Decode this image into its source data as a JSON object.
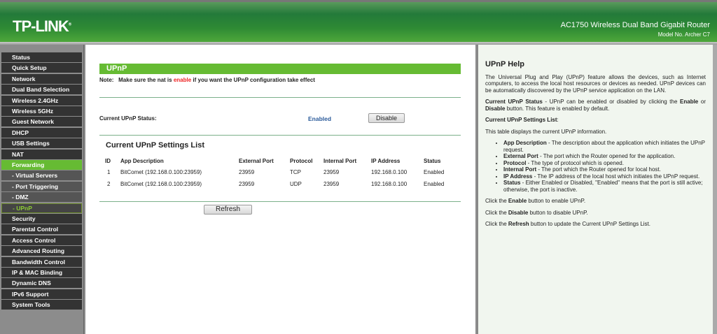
{
  "header": {
    "brand": "TP-LINK",
    "product": "AC1750 Wireless Dual Band Gigabit Router",
    "model": "Model No. Archer C7"
  },
  "sidebar": {
    "items": [
      {
        "label": "Status",
        "type": "main"
      },
      {
        "label": "Quick Setup",
        "type": "main"
      },
      {
        "label": "Network",
        "type": "main"
      },
      {
        "label": "Dual Band Selection",
        "type": "main"
      },
      {
        "label": "Wireless 2.4GHz",
        "type": "main"
      },
      {
        "label": "Wireless 5GHz",
        "type": "main"
      },
      {
        "label": "Guest Network",
        "type": "main"
      },
      {
        "label": "DHCP",
        "type": "main"
      },
      {
        "label": "USB Settings",
        "type": "main"
      },
      {
        "label": "NAT",
        "type": "main"
      },
      {
        "label": "Forwarding",
        "type": "active"
      },
      {
        "label": "- Virtual Servers",
        "type": "sub"
      },
      {
        "label": "- Port Triggering",
        "type": "sub"
      },
      {
        "label": "- DMZ",
        "type": "sub"
      },
      {
        "label": "- UPnP",
        "type": "cur"
      },
      {
        "label": "Security",
        "type": "main"
      },
      {
        "label": "Parental Control",
        "type": "main"
      },
      {
        "label": "Access Control",
        "type": "main"
      },
      {
        "label": "Advanced Routing",
        "type": "main"
      },
      {
        "label": "Bandwidth Control",
        "type": "main"
      },
      {
        "label": "IP & MAC Binding",
        "type": "main"
      },
      {
        "label": "Dynamic DNS",
        "type": "main"
      },
      {
        "label": "IPv6 Support",
        "type": "main"
      },
      {
        "label": "System Tools",
        "type": "main"
      }
    ]
  },
  "main": {
    "title": "UPnP",
    "note_label": "Note:",
    "note_pre": "Make sure the nat is ",
    "note_red": "enable",
    "note_post": " if you want the UPnP configuration take effect",
    "status_label": "Current UPnP Status:",
    "status_value": "Enabled",
    "disable_button": "Disable",
    "list_title": "Current UPnP Settings List",
    "columns": [
      "ID",
      "App Description",
      "External Port",
      "Protocol",
      "Internal Port",
      "IP Address",
      "Status"
    ],
    "rows": [
      [
        "1",
        "BitComet (192.168.0.100:23959)",
        "23959",
        "TCP",
        "23959",
        "192.168.0.100",
        "Enabled"
      ],
      [
        "2",
        "BitComet (192.168.0.100:23959)",
        "23959",
        "UDP",
        "23959",
        "192.168.0.100",
        "Enabled"
      ]
    ],
    "refresh_button": "Refresh"
  },
  "help": {
    "title": "UPnP Help",
    "intro": "The Universal Plug and Play (UPnP) feature allows the devices, such as Internet computers, to access the local host resources or devices as needed. UPnP devices can be automatically discovered by the UPnP service application on the LAN.",
    "status_b": "Current UPnP Status",
    "status_t1": " - UPnP can be enabled or disabled by clicking the ",
    "enable": "Enable",
    "or": " or ",
    "disable": "Disable",
    "status_t2": " button. This feature is enabled by default.",
    "list_b": "Current UPnP Settings List",
    "colon": ":",
    "list_t": "This table displays the current UPnP information.",
    "bullets": [
      {
        "b": "App Description",
        "t": " - The description about the application which initiates the UPnP request."
      },
      {
        "b": "External Port",
        "t": " - The port which the Router opened for the application."
      },
      {
        "b": "Protocol",
        "t": " - The type of protocol which is opened."
      },
      {
        "b": "Internal Port",
        "t": " - The port which the Router opened for local host."
      },
      {
        "b": "IP Address",
        "t": " - The IP address of the local host which initiates the UPnP request."
      },
      {
        "b": "Status",
        "t": " - Either Enabled or Disabled, \"Enabled\" means that the port is still active; otherwise, the port is inactive."
      }
    ],
    "click": "Click the ",
    "refresh": "Refresh",
    "c1": " button to enable UPnP.",
    "c2": " button to disable UPnP.",
    "c3": " button to update the Current UPnP Settings List."
  }
}
